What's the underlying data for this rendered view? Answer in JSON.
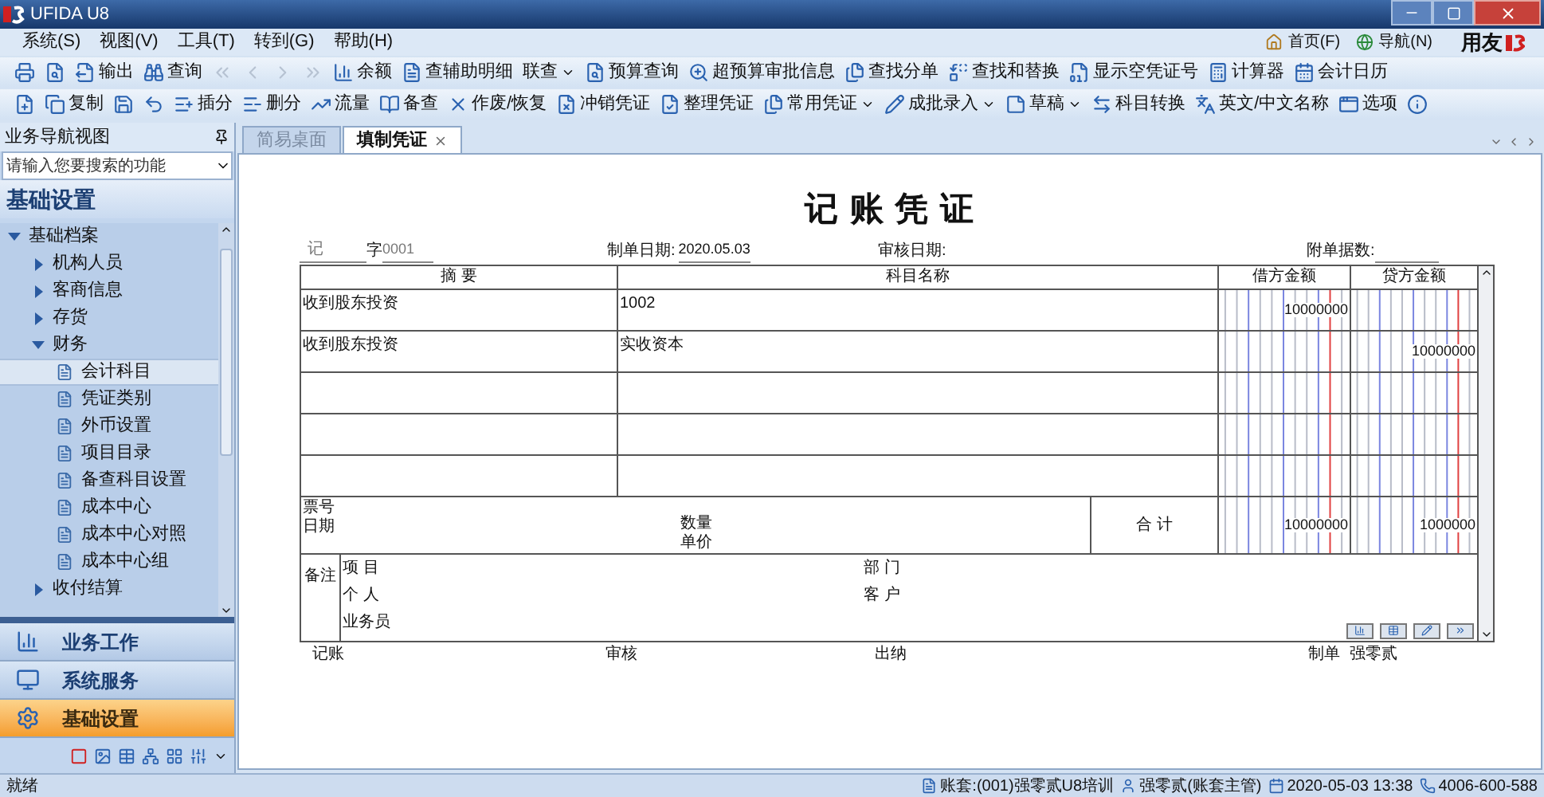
{
  "window": {
    "title": "UFIDA U8"
  },
  "menu": [
    {
      "label": "系统(S)"
    },
    {
      "label": "视图(V)"
    },
    {
      "label": "工具(T)"
    },
    {
      "label": "转到(G)"
    },
    {
      "label": "帮助(H)"
    }
  ],
  "top_links": [
    {
      "label": "首页(F)"
    },
    {
      "label": "导航(N)"
    }
  ],
  "brand": "用友",
  "toolbar_1": [
    {
      "kind": "icon",
      "disabled": false,
      "dropdown": false
    },
    {
      "kind": "icon",
      "disabled": false,
      "dropdown": false
    },
    {
      "kind": "labeled",
      "label": "输出",
      "disabled": false,
      "dropdown": false
    },
    {
      "kind": "labeled",
      "label": "查询",
      "disabled": false,
      "dropdown": false
    },
    {
      "kind": "icon",
      "disabled": true,
      "dropdown": false
    },
    {
      "kind": "icon",
      "disabled": true,
      "dropdown": false
    },
    {
      "kind": "icon",
      "disabled": true,
      "dropdown": false
    },
    {
      "kind": "icon",
      "disabled": true,
      "dropdown": false
    },
    {
      "kind": "labeled",
      "label": "余额",
      "disabled": false,
      "dropdown": false
    },
    {
      "kind": "labeled",
      "label": "查辅助明细",
      "disabled": false,
      "dropdown": false
    },
    {
      "kind": "text",
      "label": "联查",
      "disabled": false,
      "dropdown": true
    },
    {
      "kind": "labeled",
      "label": "预算查询",
      "disabled": false,
      "dropdown": false
    },
    {
      "kind": "labeled",
      "label": "超预算审批信息",
      "disabled": false,
      "dropdown": false
    },
    {
      "kind": "labeled",
      "label": "查找分单",
      "disabled": false,
      "dropdown": false
    },
    {
      "kind": "labeled",
      "label": "查找和替换",
      "disabled": false,
      "dropdown": false
    },
    {
      "kind": "labeled",
      "label": "显示空凭证号",
      "disabled": false,
      "dropdown": false
    },
    {
      "kind": "labeled",
      "label": "计算器",
      "disabled": false,
      "dropdown": false
    },
    {
      "kind": "labeled",
      "label": "会计日历",
      "disabled": false,
      "dropdown": false
    }
  ],
  "toolbar_2": [
    {
      "kind": "icon",
      "dropdown": false
    },
    {
      "kind": "labeled",
      "label": "复制",
      "dropdown": false
    },
    {
      "kind": "icon",
      "dropdown": false
    },
    {
      "kind": "icon",
      "dropdown": false
    },
    {
      "kind": "labeled",
      "label": "插分",
      "dropdown": false
    },
    {
      "kind": "labeled",
      "label": "删分",
      "dropdown": false
    },
    {
      "kind": "labeled",
      "label": "流量",
      "dropdown": false
    },
    {
      "kind": "labeled",
      "label": "备查",
      "dropdown": false
    },
    {
      "kind": "labeled",
      "label": "作废/恢复",
      "dropdown": false
    },
    {
      "kind": "labeled",
      "label": "冲销凭证",
      "dropdown": false
    },
    {
      "kind": "labeled",
      "label": "整理凭证",
      "dropdown": false
    },
    {
      "kind": "labeled",
      "label": "常用凭证",
      "dropdown": true
    },
    {
      "kind": "labeled",
      "label": "成批录入",
      "dropdown": true
    },
    {
      "kind": "labeled",
      "label": "草稿",
      "dropdown": true
    },
    {
      "kind": "labeled",
      "label": "科目转换",
      "dropdown": false
    },
    {
      "kind": "labeled",
      "label": "英文/中文名称",
      "dropdown": false
    },
    {
      "kind": "labeled",
      "label": "选项",
      "dropdown": false
    },
    {
      "kind": "icon",
      "dropdown": false
    }
  ],
  "nav_panel": {
    "title": "业务导航视图",
    "search": {
      "placeholder": "请输入您要搜索的功能"
    },
    "section_title": "基础设置",
    "tree": [
      {
        "kind": "group",
        "label": "基础档案",
        "expanded": true,
        "selected": false,
        "children": [
          {
            "kind": "group",
            "label": "机构人员",
            "expanded": false,
            "selected": false
          },
          {
            "kind": "group",
            "label": "客商信息",
            "expanded": false,
            "selected": false
          },
          {
            "kind": "group",
            "label": "存货",
            "expanded": false,
            "selected": false
          },
          {
            "kind": "group",
            "label": "财务",
            "expanded": true,
            "selected": false,
            "children": [
              {
                "kind": "item",
                "label": "会计科目",
                "selected": true
              },
              {
                "kind": "item",
                "label": "凭证类别",
                "selected": false
              },
              {
                "kind": "item",
                "label": "外币设置",
                "selected": false
              },
              {
                "kind": "item",
                "label": "项目目录",
                "selected": false
              },
              {
                "kind": "item",
                "label": "备查科目设置",
                "selected": false
              },
              {
                "kind": "item",
                "label": "成本中心",
                "selected": false
              },
              {
                "kind": "item",
                "label": "成本中心对照",
                "selected": false
              },
              {
                "kind": "item",
                "label": "成本中心组",
                "selected": false
              }
            ]
          },
          {
            "kind": "group",
            "label": "收付结算",
            "expanded": false,
            "selected": false
          }
        ]
      }
    ],
    "modules": [
      {
        "label": "业务工作",
        "selected": false
      },
      {
        "label": "系统服务",
        "selected": false
      },
      {
        "label": "基础设置",
        "selected": true
      }
    ]
  },
  "tabs": [
    {
      "label": "简易桌面",
      "selected": false,
      "closable": false
    },
    {
      "label": "填制凭证",
      "selected": true,
      "closable": true
    }
  ],
  "voucher": {
    "title": "记 账 凭 证",
    "type": "记",
    "word_label": "字",
    "number": "0001",
    "date_label": "制单日期:",
    "date": "2020.05.03",
    "audit_label": "审核日期:",
    "attachments_label": "附单据数:",
    "columns": [
      "摘 要",
      "科目名称",
      "借方金额",
      "贷方金额"
    ],
    "rows": [
      {
        "summary": "收到股东投资",
        "account": "1002",
        "debit": "10000000"
      },
      {
        "summary": "收到股东投资",
        "account": "实收资本",
        "credit": "10000000"
      },
      {},
      {},
      {}
    ],
    "ticket_labels": [
      "票号",
      "日期"
    ],
    "quantity_labels": [
      "数量",
      "单价"
    ],
    "total_label": "合 计",
    "total_debit": "10000000",
    "total_credit": "1000000",
    "remarks_label": "备注",
    "remark_fields_left": [
      "项 目",
      "个 人",
      "业务员"
    ],
    "remark_fields_right": [
      "部 门",
      "客 户"
    ],
    "signatures": [
      "记账",
      "审核",
      "出纳",
      "制单"
    ],
    "maker": "强零贰"
  },
  "status_bar": {
    "message": "就绪",
    "items": [
      {
        "label": "账套:(001)强零贰U8培训"
      },
      {
        "label": "强零贰(账套主管)"
      },
      {
        "label": "2020-05-03 13:38"
      },
      {
        "label": "4006-600-588"
      }
    ]
  }
}
